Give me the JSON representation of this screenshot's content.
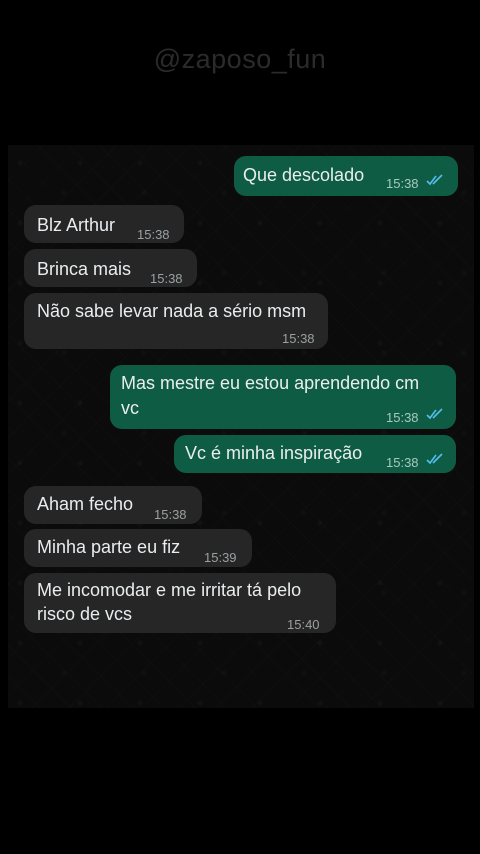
{
  "watermark": "@zaposo_fun",
  "messages": [
    {
      "text": "Que descolado",
      "time": "15:38",
      "direction": "out",
      "read": true
    },
    {
      "text": "Blz Arthur",
      "time": "15:38",
      "direction": "in"
    },
    {
      "text": "Brinca mais",
      "time": "15:38",
      "direction": "in"
    },
    {
      "text": "Não sabe levar nada a sério msm",
      "time": "15:38",
      "direction": "in"
    },
    {
      "line1": "Mas mestre eu estou aprendendo cm",
      "line2": "vc",
      "time": "15:38",
      "direction": "out",
      "read": true
    },
    {
      "text": "Vc é minha inspiração",
      "time": "15:38",
      "direction": "out",
      "read": true
    },
    {
      "text": "Aham fecho",
      "time": "15:38",
      "direction": "in"
    },
    {
      "text": "Minha parte eu fiz",
      "time": "15:39",
      "direction": "in"
    },
    {
      "line1": "Me incomodar e me irritar tá pelo",
      "line2": "risco de vcs",
      "time": "15:40",
      "direction": "in"
    }
  ],
  "colors": {
    "outgoing_bubble": "#0f5c44",
    "incoming_bubble": "#262626",
    "read_ticks": "#53bdeb"
  },
  "icons": {
    "read_receipt": "double-check-icon"
  }
}
